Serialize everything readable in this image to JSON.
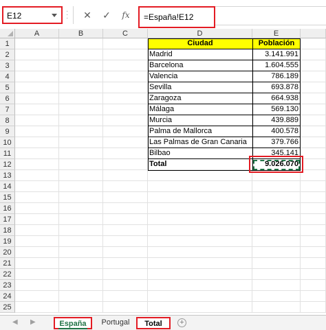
{
  "formula_bar": {
    "name_box": "E12",
    "cancel_icon": "✕",
    "enter_icon": "✓",
    "fx_label": "fx",
    "formula": "=España!E12"
  },
  "columns": [
    "A",
    "B",
    "C",
    "D",
    "E"
  ],
  "rows": [
    "1",
    "2",
    "3",
    "4",
    "5",
    "6",
    "7",
    "8",
    "9",
    "10",
    "11",
    "12",
    "13",
    "14",
    "15",
    "16",
    "17",
    "18",
    "19",
    "20",
    "21",
    "22",
    "23",
    "24",
    "25"
  ],
  "table": {
    "header_city": "Ciudad",
    "header_population": "Población",
    "rows": [
      {
        "city": "Madrid",
        "population": "3.141.991"
      },
      {
        "city": "Barcelona",
        "population": "1.604.555"
      },
      {
        "city": "Valencia",
        "population": "786.189"
      },
      {
        "city": "Sevilla",
        "population": "693.878"
      },
      {
        "city": "Zaragoza",
        "population": "664.938"
      },
      {
        "city": "Málaga",
        "population": "569.130"
      },
      {
        "city": "Murcia",
        "population": "439.889"
      },
      {
        "city": "Palma de Mallorca",
        "population": "400.578"
      },
      {
        "city": "Las Palmas de Gran Canaria",
        "population": "379.766"
      },
      {
        "city": "Bilbao",
        "population": "345.141"
      }
    ],
    "total_label": "Total",
    "total_value": "9.026.070"
  },
  "sheet_tabs": [
    {
      "label": "España"
    },
    {
      "label": "Portugal"
    },
    {
      "label": "Total"
    }
  ],
  "colors": {
    "header_fill": "#ffff00",
    "highlight": "#e31b23",
    "excel_green": "#217346"
  }
}
